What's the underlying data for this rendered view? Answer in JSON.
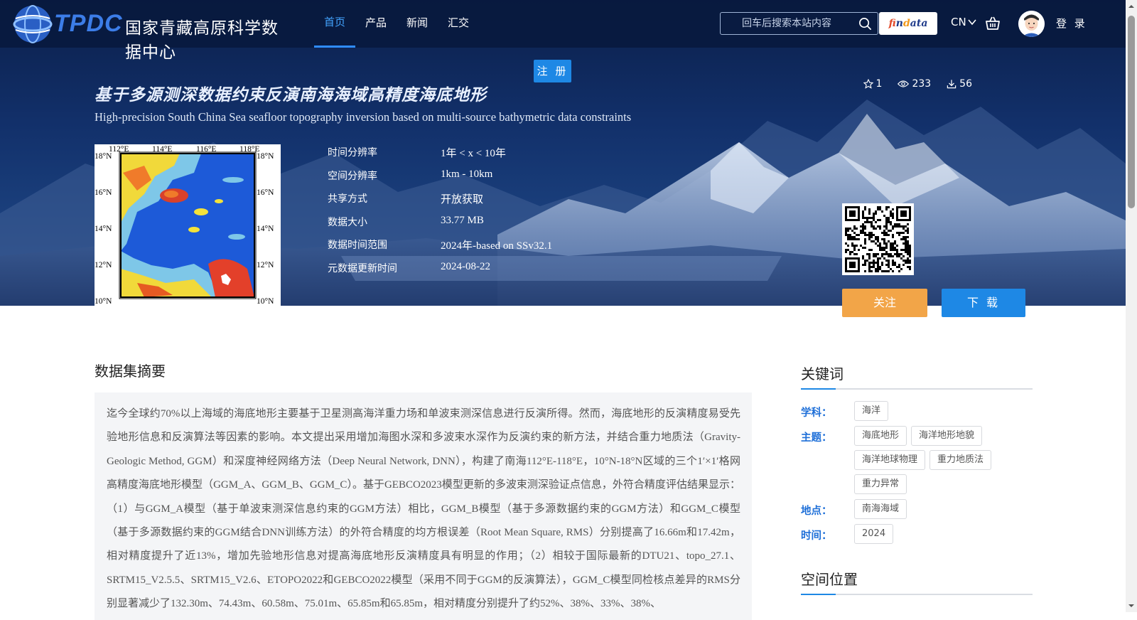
{
  "nav": {
    "logo_text": "TPDC",
    "logo_cn": "国家青藏高原科学数据中心",
    "menu": [
      "首页",
      "产品",
      "新闻",
      "汇交"
    ],
    "search_placeholder": "回车后搜索本站内容",
    "findata": "findata",
    "lang": "CN",
    "login": "登 录"
  },
  "register": "注 册",
  "dataset": {
    "title_cn": "基于多源测深数据约束反演南海海域高精度海底地形",
    "title_en": "High-precision South China Sea seafloor topography inversion based on multi-source bathymetric data constraints",
    "stats": {
      "favorites": "1",
      "views": "233",
      "downloads": "56"
    },
    "meta": [
      {
        "label": "时间分辨率",
        "value": "1年 < x < 10年"
      },
      {
        "label": "空间分辨率",
        "value": "1km - 10km"
      },
      {
        "label": "共享方式",
        "value": "开放获取"
      },
      {
        "label": "数据大小",
        "value": "33.77 MB"
      },
      {
        "label": "数据时间范围",
        "value": "2024年-based on SSv32.1"
      },
      {
        "label": "元数据更新时间",
        "value": "2024-08-22"
      }
    ],
    "buttons": {
      "follow": "关注",
      "download": "下 载"
    }
  },
  "map_thumb": {
    "top_labels": [
      "112°E",
      "114°E",
      "116°E",
      "118°E"
    ],
    "left_labels": [
      "18°N",
      "16°N",
      "14°N",
      "12°N",
      "10°N"
    ],
    "right_labels": [
      "18°N",
      "16°N",
      "14°N",
      "12°N",
      "10°N"
    ]
  },
  "abstract": {
    "heading": "数据集摘要",
    "text": "迄今全球约70%以上海域的海底地形主要基于卫星测高海洋重力场和单波束测深信息进行反演所得。然而，海底地形的反演精度易受先验地形信息和反演算法等因素的影响。本文提出采用增加海图水深和多波束水深作为反演约束的新方法，并结合重力地质法（Gravity-Geologic Method, GGM）和深度神经网络方法（Deep Neural Network, DNN），构建了南海112°E-118°E，10°N-18°N区域的三个1′×1′格网高精度海底地形模型（GGM_A、GGM_B、GGM_C）。基于GEBCO2023模型更新的多波束测深验证点信息，外符合精度评估结果显示：（1）与GGM_A模型（基于单波束测深信息约束的GGM方法）相比，GGM_B模型（基于多源数据约束的GGM方法）和GGM_C模型（基于多源数据约束的GGM结合DNN训练方法）的外符合精度的均方根误差（Root Mean Square, RMS）分别提高了16.66m和17.42m，相对精度提升了近13%，增加先验地形信息对提高海底地形反演精度具有明显的作用；（2）相较于国际最新的DTU21、topo_27.1、SRTM15_V2.5.5、SRTM15_V2.6、ETOPO2022和GEBCO2022模型（采用不同于GGM的反演算法），GGM_C模型同检核点差异的RMS分别显著减少了132.30m、74.43m、60.58m、75.01m、65.85m和65.85m，相对精度分别提升了约52%、38%、33%、38%、"
  },
  "keywords": {
    "heading": "关键词",
    "groups": [
      {
        "label": "学科：",
        "tags": [
          "海洋"
        ]
      },
      {
        "label": "主题：",
        "tags": [
          "海底地形",
          "海洋地形地貌",
          "海洋地球物理",
          "重力地质法",
          "重力异常"
        ]
      },
      {
        "label": "地点：",
        "tags": [
          "南海海域"
        ]
      },
      {
        "label": "时间：",
        "tags": [
          "2024"
        ]
      }
    ]
  },
  "spatial": {
    "heading": "空间位置"
  },
  "colors": {
    "accent": "#1e88e5",
    "follow": "#f2a548",
    "nav_active": "#43a4ff",
    "keyword_label": "#1e6fd8"
  }
}
